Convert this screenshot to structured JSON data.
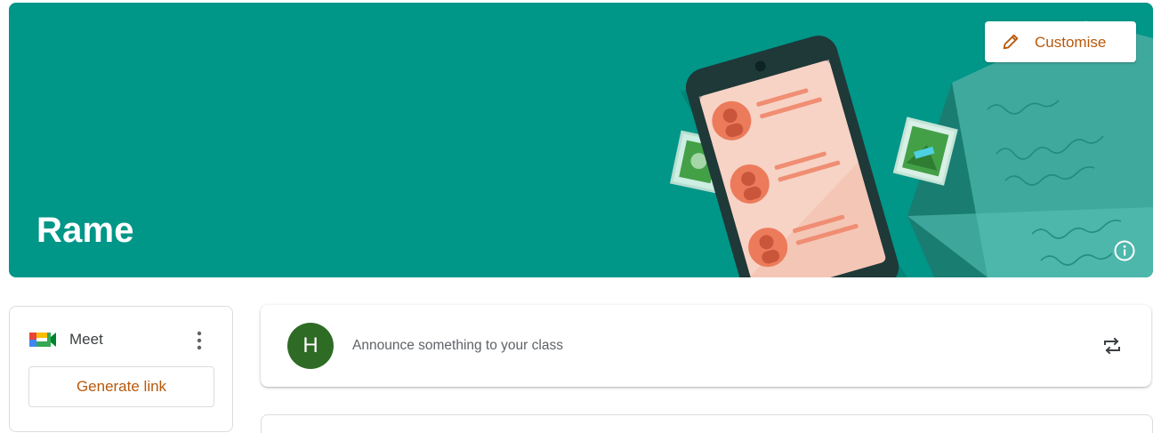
{
  "banner": {
    "class_name": "Rame",
    "customise_label": "Customise",
    "background_color": "#009688",
    "illustration": "phone-contacts-letters",
    "info_icon": "info-icon"
  },
  "meet": {
    "title": "Meet",
    "generate_link_label": "Generate link",
    "more_icon": "more-vert-icon"
  },
  "announce": {
    "avatar_letter": "H",
    "avatar_color": "#2e6b25",
    "placeholder": "Announce something to your class",
    "repost_icon": "repost-icon"
  },
  "colors": {
    "accent": "#b7590c"
  }
}
